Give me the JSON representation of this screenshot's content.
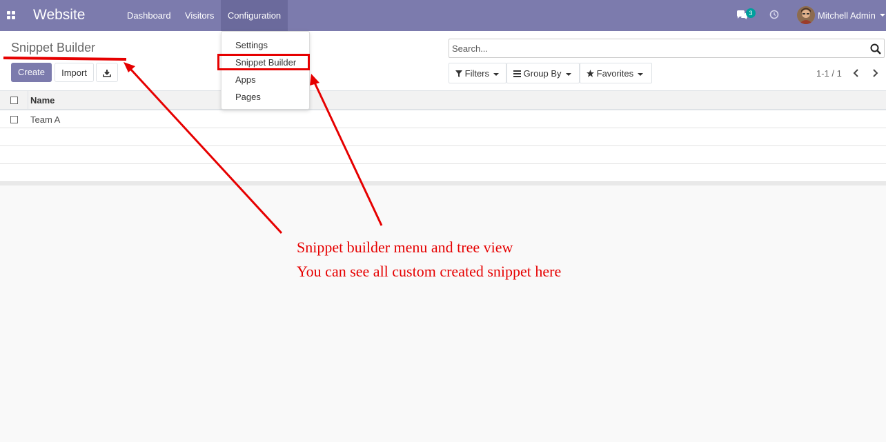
{
  "navbar": {
    "brand": "Website",
    "menu": [
      "Dashboard",
      "Visitors",
      "Configuration"
    ],
    "chat_badge": "3",
    "user_name": "Mitchell Admin",
    "bg_color": "#7c7bad"
  },
  "control_panel": {
    "breadcrumb": "Snippet Builder",
    "create_label": "Create",
    "import_label": "Import",
    "search_placeholder": "Search...",
    "filters_label": "Filters",
    "group_by_label": "Group By",
    "favorites_label": "Favorites",
    "pager_value": "1-1 / 1"
  },
  "list": {
    "column_name": "Name",
    "rows": [
      "Team A"
    ]
  },
  "dropdown": {
    "items": [
      "Settings",
      "Snippet Builder",
      "Apps",
      "Pages"
    ],
    "highlighted": "Snippet Builder"
  },
  "annotations": {
    "line1": "Snippet builder menu and tree view",
    "line2": "You can see all custom created snippet here",
    "color": "#e60000"
  }
}
